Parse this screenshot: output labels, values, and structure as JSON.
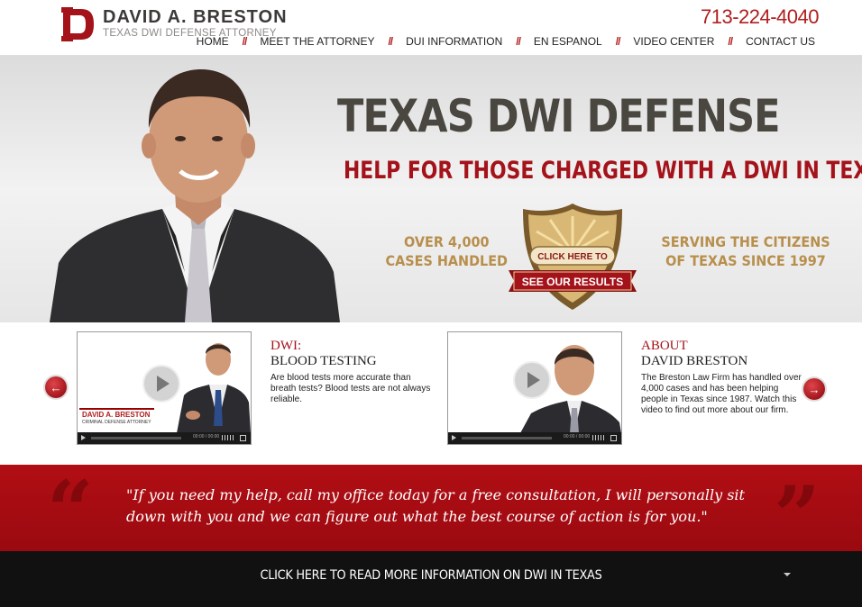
{
  "header": {
    "brand_name": "DAVID A. BRESTON",
    "brand_tagline": "TEXAS DWI DEFENSE ATTORNEY",
    "phone": "713-224-4040",
    "nav": [
      "HOME",
      "MEET THE ATTORNEY",
      "DUI INFORMATION",
      "EN ESPANOL",
      "VIDEO CENTER",
      "CONTACT US"
    ],
    "separator": "//"
  },
  "hero": {
    "title": "TEXAS DWI DEFENSE",
    "subtitle": "HELP FOR THOSE CHARGED WITH A DWI IN TEXAS",
    "stat_left": [
      "OVER 4,000",
      "CASES HANDLED"
    ],
    "stat_right": [
      "SERVING THE CITIZENS",
      "OF TEXAS SINCE 1997"
    ],
    "badge_top": "CLICK HERE TO",
    "badge_main": "SEE OUR RESULTS"
  },
  "videos": [
    {
      "kicker": "DWI:",
      "title": "BLOOD TESTING",
      "description": "Are blood tests more accurate than breath tests? Blood tests are not always reliable.",
      "overlay_name": "DAVID A. BRESTON",
      "overlay_sub": "CRIMINAL DEFENSE ATTORNEY",
      "time": "00:00 / 00:00"
    },
    {
      "kicker": "ABOUT",
      "title": "DAVID BRESTON",
      "description": "The Breston Law Firm has handled over 4,000 cases and has been helping people in Texas since 1987. Watch this video to find out more about our firm.",
      "time": "00:00 / 00:00"
    }
  ],
  "quote": {
    "open_mark": "“",
    "close_mark": "”",
    "text": "\"If you need my help, call my office today for a free consultation, I will personally sit down with you and we can figure out what the best course of action is for you.\""
  },
  "footer": {
    "link_text": "CLICK HERE TO READ MORE INFORMATION ON DWI IN TEXAS"
  },
  "colors": {
    "brand_red": "#a4121a",
    "gold": "#b88f4d",
    "dark_text": "#4a4741"
  }
}
